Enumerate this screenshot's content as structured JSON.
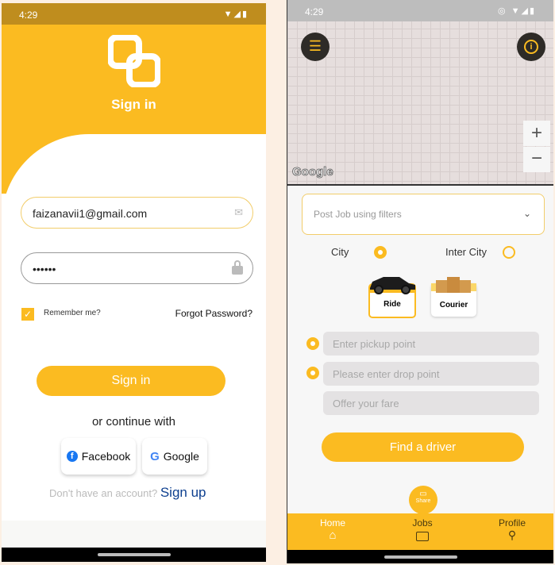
{
  "signin_screen": {
    "status": {
      "time": "4:29",
      "icons": "▼◢▮"
    },
    "logo": "app-logo",
    "title": "Sign in",
    "email": {
      "value": "faizanavii1@gmail.com",
      "icon": "mail-icon"
    },
    "password": {
      "value": "••••••",
      "icon": "lock-icon"
    },
    "remember": {
      "label": "Remember me?",
      "checked": true
    },
    "forgot": "Forgot Password?",
    "signin_button": "Sign in",
    "continue_with": "or continue with",
    "facebook": "Facebook",
    "google": "Google",
    "no_account": "Don't have an account?",
    "signup": "Sign up"
  },
  "home_screen": {
    "status": {
      "time": "4:29",
      "icons": "◎ ▼◢▮"
    },
    "map": {
      "attribution": "Google",
      "zoom_in": "+",
      "zoom_out": "−"
    },
    "filter_dropdown": "Post Job using filters",
    "trip_types": [
      {
        "label": "City",
        "selected": true
      },
      {
        "label": "Inter City",
        "selected": false
      }
    ],
    "services": [
      {
        "label": "Ride",
        "selected": true
      },
      {
        "label": "Courier",
        "selected": false
      }
    ],
    "pickup_placeholder": "Enter pickup point",
    "drop_placeholder": "Please enter drop point",
    "fare_placeholder": "Offer your fare",
    "find_button": "Find a driver",
    "share": "Share",
    "tabs": [
      {
        "label": "Home",
        "icon": "home-icon",
        "active": true
      },
      {
        "label": "Jobs",
        "icon": "briefcase-icon"
      },
      {
        "label": "Profile",
        "icon": "user-icon"
      }
    ]
  },
  "colors": {
    "accent": "#fbbb21",
    "link": "#0d3f8f"
  }
}
